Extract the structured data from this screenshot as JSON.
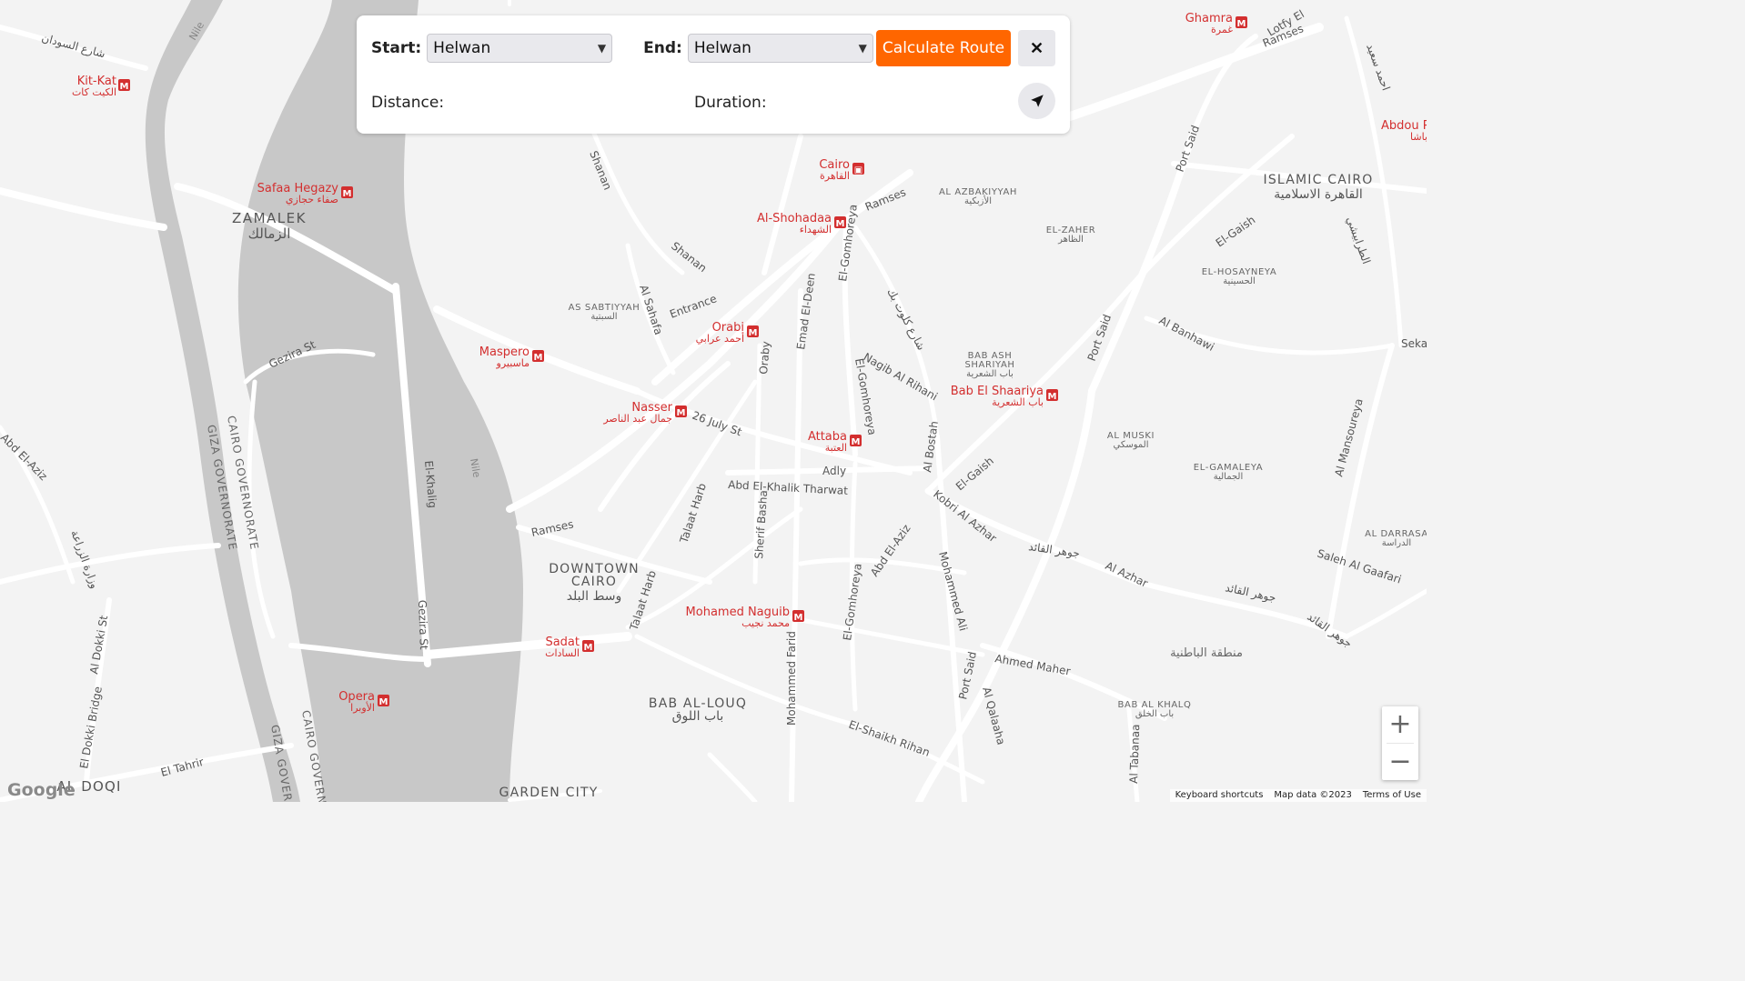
{
  "controls": {
    "start_label": "Start:",
    "start_value": "Helwan",
    "end_label": "End:",
    "end_value": "Helwan",
    "calculate_label": "Calculate Route",
    "close_symbol": "✕",
    "distance_label": "Distance:",
    "distance_value": "",
    "duration_label": "Duration:",
    "duration_value": "",
    "locate_icon": "navigation-arrow-icon"
  },
  "zoom": {
    "in": "+",
    "out": "−"
  },
  "footer": {
    "shortcuts": "Keyboard shortcuts",
    "map_data": "Map data ©2023",
    "terms": "Terms of Use"
  },
  "google_logo": "Google",
  "colors": {
    "accent": "#ff6600",
    "metro": "#d32f2f",
    "river": "#c8c8c8",
    "land": "#f3f3f3",
    "road": "#ffffff"
  },
  "map": {
    "stations": [
      {
        "name": "Kit-Kat",
        "ar": "الكيت كات"
      },
      {
        "name": "Safaa Hegazy",
        "ar": "صفاء حجازي"
      },
      {
        "name": "Cairo",
        "ar": "القاهرة"
      },
      {
        "name": "Al-Shohadaa",
        "ar": "الشهداء"
      },
      {
        "name": "Orabi",
        "ar": "أحمد عرابي"
      },
      {
        "name": "Maspero",
        "ar": "ماسبيرو"
      },
      {
        "name": "Nasser",
        "ar": "جمال عبد الناصر"
      },
      {
        "name": "Attaba",
        "ar": "العتبة"
      },
      {
        "name": "Bab El Shaariya",
        "ar": "باب الشعرية"
      },
      {
        "name": "Mohamed Naguib",
        "ar": "محمد نجيب"
      },
      {
        "name": "Sadat",
        "ar": "السادات"
      },
      {
        "name": "Opera",
        "ar": "الأوبرا"
      },
      {
        "name": "Ghamra",
        "ar": "غمرة"
      },
      {
        "name": "Abdou P",
        "ar": "عبده باشا"
      }
    ],
    "districts": [
      {
        "name": "ZAMALEK",
        "ar": "الزمالك"
      },
      {
        "name": "ISLAMIC CAIRO",
        "ar": "القاهرة الاسلامية"
      },
      {
        "name": "DOWNTOWN",
        "name2": "CAIRO",
        "ar": "وسط البلد"
      },
      {
        "name": "BAB AL-LOUQ",
        "ar": "باب اللوق"
      },
      {
        "name": "GARDEN CITY"
      },
      {
        "name": "AL DOQI"
      }
    ],
    "neighborhoods": [
      {
        "name": "AL AZBAKIYYAH",
        "ar": "الأزبكية"
      },
      {
        "name": "EL-ZAHER",
        "ar": "الظاهر"
      },
      {
        "name": "EL-HOSAYNEYA",
        "ar": "الحسينية"
      },
      {
        "name": "AS SABTIYYAH",
        "ar": "السبتية"
      },
      {
        "name": "BAB ASH",
        "name2": "SHARIYAH",
        "ar": "باب الشعرية"
      },
      {
        "name": "AL MUSKI",
        "ar": "الموسكي"
      },
      {
        "name": "EL-GAMALEYA",
        "ar": "الجمالية"
      },
      {
        "name": "AL DARRASA",
        "ar": "الدراسة"
      },
      {
        "name": "BAB AL KHALQ",
        "ar": "باب الخلق"
      },
      {
        "name_ar": "منطقة الباطنية"
      }
    ],
    "streets": [
      "Shanan",
      "Ramses",
      "Entrance",
      "Al Sahafa",
      "Emad El-Deen",
      "Oraby",
      "26 July St",
      "Adly",
      "Abd El-Khalik Tharwat",
      "Talaat Harb",
      "Sherif Basha",
      "El-Gomhoreya",
      "Nagib Al Rihani",
      "Al Bostah",
      "El-Gaish",
      "Kobri Al Azhar",
      "Port Said",
      "Al Banhawi",
      "Al Azhar",
      "Saleh Al Gaafari",
      "Al Mansoureya",
      "Mohammed Ali",
      "Ahmed Maher",
      "Al Qalaaha",
      "Al Tabanaa",
      "El-Shaikh Rihan",
      "Mohammed Farid",
      "El Tahrir",
      "Al Dokki St",
      "El Dokki Bridge",
      "Gezira St",
      "El-Khalig",
      "Nile",
      "Lotfy El",
      "Sekat",
      "Abd El-Aziz",
      "Abd El-Aziz",
      "Maspero",
      "Ramses"
    ],
    "street_ar": [
      "شارع السودان",
      "شارع كلوت بك",
      "جوهر القائد",
      "جوهر القائد",
      "وزارة الزراعة",
      "احمد سعيد",
      "الظاهر",
      "الطرابيشي"
    ],
    "governorates": [
      "CAIRO GOVERNORATE",
      "GIZA GOVERNORATE",
      "GIZA GOVERN",
      "CAIRO GOVERN"
    ]
  }
}
